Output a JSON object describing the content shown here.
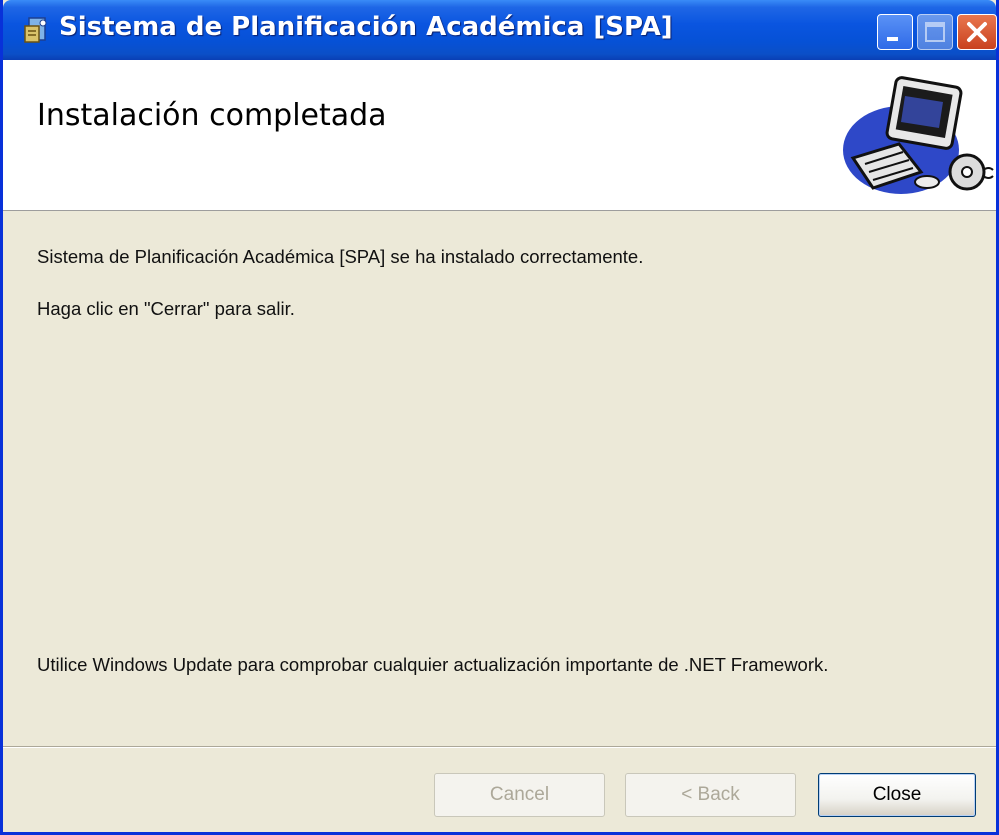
{
  "window": {
    "title": "Sistema de Planificación Académica [SPA]",
    "accent_color": "#0a55e0",
    "icons": [
      "installer-app-icon",
      "minimize-icon",
      "maximize-icon",
      "close-icon"
    ]
  },
  "banner": {
    "title": "Instalación completada",
    "art_icon": "computer-cd-clipart"
  },
  "content": {
    "success_message": "Sistema de Planificación Académica [SPA] se ha instalado correctamente.",
    "exit_instruction": "Haga clic en \"Cerrar\" para salir.",
    "update_notice": "Utilice Windows Update para comprobar cualquier actualización importante de .NET Framework."
  },
  "buttons": {
    "cancel": {
      "label": "Cancel",
      "enabled": false
    },
    "back": {
      "label": "< Back",
      "enabled": false
    },
    "close": {
      "label": "Close",
      "enabled": true
    }
  }
}
